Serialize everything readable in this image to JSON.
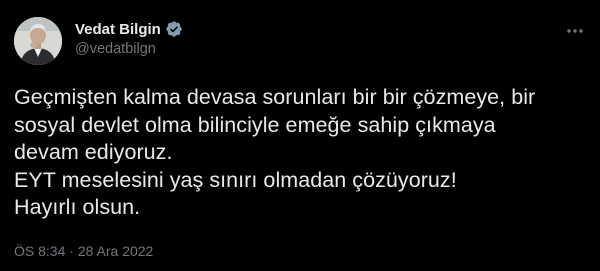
{
  "author": {
    "display_name": "Vedat Bilgin",
    "handle": "@vedatbilgn",
    "verified": true,
    "avatar_icon": "profile-photo"
  },
  "tweet": {
    "lines": [
      "Geçmişten kalma devasa sorunları bir bir çözmeye, bir",
      "sosyal devlet olma bilinciyle emeğe sahip çıkmaya",
      "devam ediyoruz.",
      "EYT meselesini yaş sınırı olmadan çözüyoruz!",
      "Hayırlı olsun."
    ],
    "time": "ÖS 8:34",
    "separator": " · ",
    "date": "28 Ara 2022"
  },
  "icons": {
    "verified": "verified-badge-icon",
    "more": "more-options-icon"
  },
  "colors": {
    "background": "#000000",
    "text": "#e7e9ea",
    "secondary_text": "#71767b",
    "verified_badge": "#829aab"
  }
}
